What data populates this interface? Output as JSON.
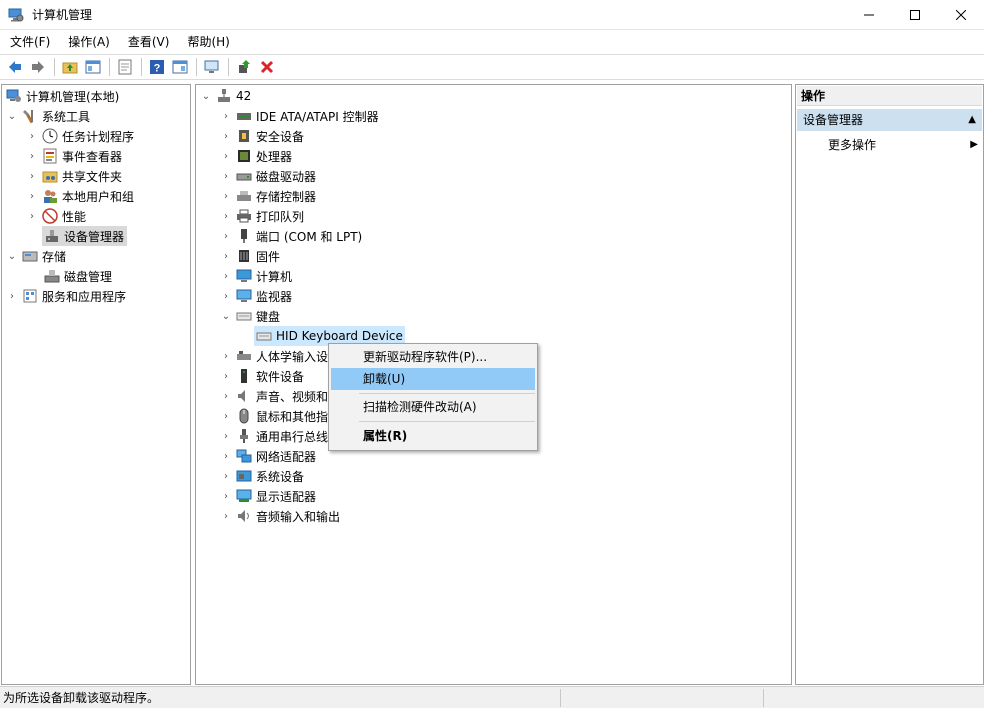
{
  "window": {
    "title": "计算机管理"
  },
  "menu": [
    "文件(F)",
    "操作(A)",
    "查看(V)",
    "帮助(H)"
  ],
  "left_tree": {
    "root": "计算机管理(本地)",
    "system_tools": "系统工具",
    "task_scheduler": "任务计划程序",
    "event_viewer": "事件查看器",
    "shared_folders": "共享文件夹",
    "local_users": "本地用户和组",
    "performance": "性能",
    "device_manager": "设备管理器",
    "storage": "存储",
    "disk_management": "磁盘管理",
    "services_apps": "服务和应用程序"
  },
  "device_tree": {
    "root": "42",
    "items": [
      "IDE ATA/ATAPI 控制器",
      "安全设备",
      "处理器",
      "磁盘驱动器",
      "存储控制器",
      "打印队列",
      "端口 (COM 和 LPT)",
      "固件",
      "计算机",
      "监视器",
      "键盘",
      "HID Keyboard Device",
      "人体学输入设",
      "软件设备",
      "声音、视频和",
      "鼠标和其他指",
      "通用串行总线",
      "网络适配器",
      "系统设备",
      "显示适配器",
      "音频输入和输出"
    ]
  },
  "context_menu": {
    "update_driver": "更新驱动程序软件(P)...",
    "uninstall": "卸载(U)",
    "scan": "扫描检测硬件改动(A)",
    "properties": "属性(R)"
  },
  "actions": {
    "header": "操作",
    "section": "设备管理器",
    "more": "更多操作"
  },
  "status": {
    "text": "为所选设备卸载该驱动程序。"
  },
  "colors": {
    "accent": "#0078d7",
    "selection": "#cce8ff",
    "menu_highlight": "#91c9f7"
  }
}
